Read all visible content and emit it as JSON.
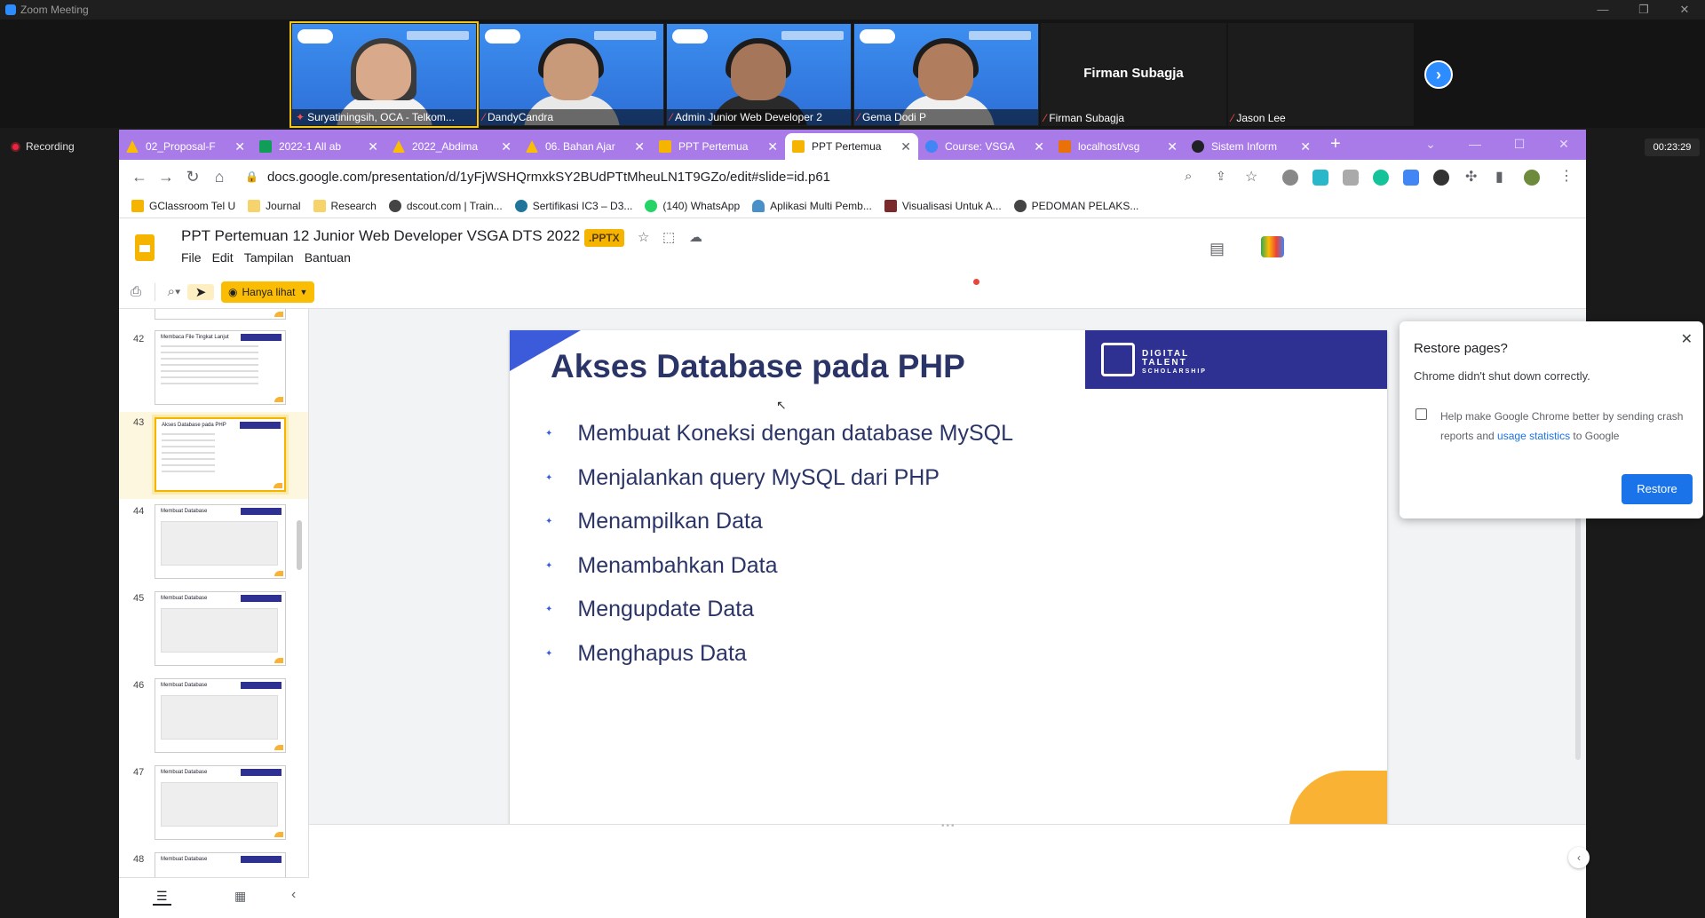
{
  "zoom": {
    "window_title": "Zoom Meeting",
    "recording_label": "Recording",
    "timer": "00:23:29",
    "participants": [
      {
        "name": "Suryatiningsih, OCA - Telkom..."
      },
      {
        "name": "DandyCandra"
      },
      {
        "name": "Admin Junior Web Developer 2"
      },
      {
        "name": "Gema Dodi P"
      },
      {
        "name": "Firman Subagja",
        "display": "Firman Subagja"
      },
      {
        "name": "Jason Lee"
      }
    ]
  },
  "chrome": {
    "tabs": [
      {
        "title": "02_Proposal-F",
        "color": "#fbbc04"
      },
      {
        "title": "2022-1 All ab",
        "color": "#0f9d58"
      },
      {
        "title": "2022_Abdima",
        "color": "#fbbc04"
      },
      {
        "title": "06. Bahan Ajar",
        "color": "#fbbc04"
      },
      {
        "title": "PPT Pertemua",
        "color": "#f4b400"
      },
      {
        "title": "PPT Pertemua",
        "color": "#f4b400"
      },
      {
        "title": "Course: VSGA",
        "color": "#4285f4"
      },
      {
        "title": "localhost/vsg",
        "color": "#e8710a"
      },
      {
        "title": "Sistem Inform",
        "color": "#202124"
      }
    ],
    "active_tab_index": 5,
    "url": "docs.google.com/presentation/d/1yFjWSHQrmxkSY2BUdPTtMheuLN1T9GZo/edit#slide=id.p61",
    "bookmarks": [
      {
        "label": "GClassroom Tel U"
      },
      {
        "label": "Journal"
      },
      {
        "label": "Research"
      },
      {
        "label": "dscout.com | Train..."
      },
      {
        "label": "Sertifikasi IC3 – D3..."
      },
      {
        "label": "(140) WhatsApp"
      },
      {
        "label": "Aplikasi Multi Pemb..."
      },
      {
        "label": "Visualisasi Untuk A..."
      },
      {
        "label": "PEDOMAN PELAKS..."
      }
    ]
  },
  "slides": {
    "doc_title": "PPT Pertemuan 12 Junior Web Developer VSGA DTS 2022",
    "badge": ".PPTX",
    "menu": [
      "File",
      "Edit",
      "Tampilan",
      "Bantuan"
    ],
    "view_mode": "Hanya lihat",
    "thumbnails": [
      {
        "num": "42",
        "title": "Membaca File Tingkat Lanjut"
      },
      {
        "num": "43",
        "title": "Akses Database pada PHP"
      },
      {
        "num": "44",
        "title": "Membuat Database"
      },
      {
        "num": "45",
        "title": "Membuat Database"
      },
      {
        "num": "46",
        "title": "Membuat Database"
      },
      {
        "num": "47",
        "title": "Membuat Database"
      },
      {
        "num": "48",
        "title": "Membuat Database"
      }
    ],
    "current_slide": {
      "title": "Akses Database pada PHP",
      "brand": [
        "DIGITAL",
        "TALENT",
        "SCHOLARSHIP"
      ],
      "bullets": [
        "Membuat Koneksi dengan database MySQL",
        "Menjalankan query MySQL dari PHP",
        "Menampilkan Data",
        "Menambahkan Data",
        "Mengupdate Data",
        "Menghapus Data"
      ]
    }
  },
  "restore_popup": {
    "title": "Restore pages?",
    "subtitle": "Chrome didn't shut down correctly.",
    "help_prefix": "Help make Google Chrome better by sending crash reports and ",
    "help_link": "usage statistics",
    "help_suffix": " to Google",
    "button": "Restore"
  }
}
